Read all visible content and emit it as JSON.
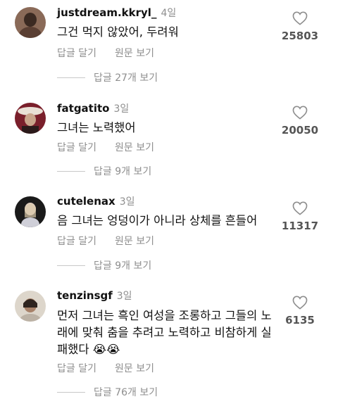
{
  "comments": [
    {
      "username": "justdream.kkryl_",
      "age": "4일",
      "text": "그건 먹지 않았어, 두려워",
      "reply_label": "답글 달기",
      "original_label": "원문 보기",
      "view_replies": "답글 27개 보기",
      "likes": "25803",
      "avatar_color": "#6b4a3a"
    },
    {
      "username": "fatgatito",
      "age": "3일",
      "text": "그녀는 노력했어",
      "reply_label": "답글 달기",
      "original_label": "원문 보기",
      "view_replies": "답글 9개 보기",
      "likes": "20050",
      "avatar_color": "#7a1f2b"
    },
    {
      "username": "cutelenax",
      "age": "3일",
      "text": "음 그녀는 엉덩이가 아니라 상체를 흔들어",
      "reply_label": "답글 달기",
      "original_label": "원문 보기",
      "view_replies": "답글 9개 보기",
      "likes": "11317",
      "avatar_color": "#222222"
    },
    {
      "username": "tenzinsgf",
      "age": "3일",
      "text": "먼저 그녀는 흑인 여성을 조롱하고 그들의 노래에 맞춰 춤을 추려고 노력하고 비참하게 실패했다 😭😭",
      "reply_label": "답글 달기",
      "original_label": "원문 보기",
      "view_replies": "답글 76개 보기",
      "likes": "6135",
      "avatar_color": "#d9d2c6"
    }
  ]
}
